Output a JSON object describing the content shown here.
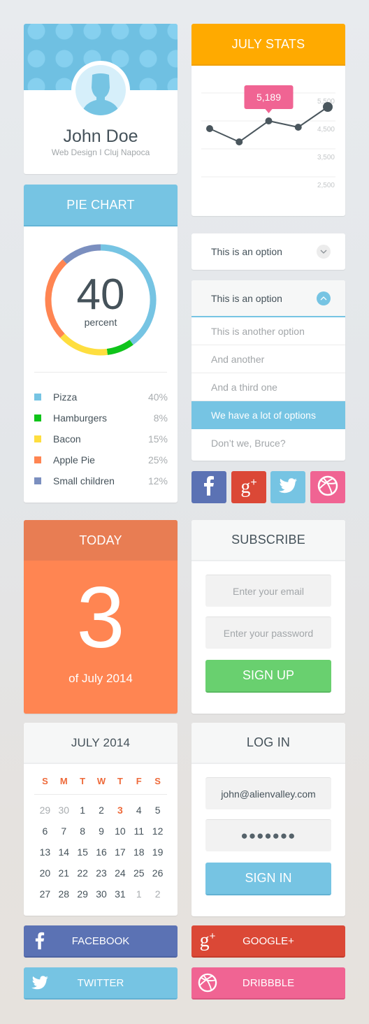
{
  "profile": {
    "name": "John Doe",
    "subtitle": "Web Design I Cluj Napoca",
    "avatar_icon": "user-silhouette-icon"
  },
  "stats": {
    "title": "JULY STATS",
    "tooltip": "5,189",
    "accent": "#ffaa00"
  },
  "chart_data": {
    "type": "line",
    "title": "JULY STATS",
    "x": [
      1,
      2,
      3,
      4,
      5
    ],
    "values": [
      4225,
      3750,
      4500,
      4275,
      5000
    ],
    "y_ticks": [
      "5,500",
      "4,500",
      "3,500",
      "2,500"
    ],
    "ylim": [
      2500,
      5500
    ],
    "grid": true,
    "annotations": [
      {
        "point_index": 2,
        "label": "5,189"
      }
    ],
    "highlight_index": 4
  },
  "pie": {
    "title": "PIE CHART",
    "center_value": "40",
    "center_label": "percent",
    "chart_data": {
      "type": "pie",
      "categories": [
        "Pizza",
        "Hamburgers",
        "Bacon",
        "Apple Pie",
        "Small children"
      ],
      "values": [
        40,
        8,
        15,
        25,
        12
      ],
      "labels": [
        "40%",
        "8%",
        "15%",
        "25%",
        "12%"
      ],
      "colors": [
        "#76c4e3",
        "#0fc41a",
        "#fede3f",
        "#ff8552",
        "#7b8fbf"
      ]
    }
  },
  "dropdown_closed": {
    "value": "This is an option",
    "icon": "chevron-down-icon"
  },
  "dropdown_open": {
    "value": "This is an option",
    "icon": "chevron-up-icon",
    "options": [
      "This is another option",
      "And another",
      "And a third one",
      "We have a lot of options",
      "Don’t we, Bruce?"
    ],
    "selected_index": 3
  },
  "social_icons": [
    {
      "name": "facebook",
      "color": "#5b72b4"
    },
    {
      "name": "google-plus",
      "color": "#db4836"
    },
    {
      "name": "twitter",
      "color": "#76c4e3"
    },
    {
      "name": "dribbble",
      "color": "#f06493"
    }
  ],
  "today": {
    "title": "TODAY",
    "day": "3",
    "month_line": "of July 2014"
  },
  "subscribe": {
    "title": "SUBSCRIBE",
    "email_placeholder": "Enter your email",
    "password_placeholder": "Enter your password",
    "button": "SIGN UP",
    "button_color": "#69d06f"
  },
  "calendar": {
    "title": "JULY 2014",
    "weekdays": [
      "S",
      "M",
      "T",
      "W",
      "T",
      "F",
      "S"
    ],
    "weeks": [
      [
        "29",
        "30",
        "1",
        "2",
        "3",
        "4",
        "5"
      ],
      [
        "6",
        "7",
        "8",
        "9",
        "10",
        "11",
        "12"
      ],
      [
        "13",
        "14",
        "15",
        "16",
        "17",
        "18",
        "19"
      ],
      [
        "20",
        "21",
        "22",
        "23",
        "24",
        "25",
        "26"
      ],
      [
        "27",
        "28",
        "29",
        "30",
        "31",
        "1",
        "2"
      ]
    ],
    "today": "3"
  },
  "login": {
    "title": "LOG IN",
    "email_value": "john@alienvalley.com",
    "password_mask": "●●●●●●●",
    "button": "SIGN IN",
    "button_color": "#76c4e3"
  },
  "social_buttons": [
    {
      "label": "FACEBOOK",
      "color": "#5b72b4"
    },
    {
      "label": "GOOGLE+",
      "color": "#db4836"
    },
    {
      "label": "TWITTER",
      "color": "#76c4e3"
    },
    {
      "label": "DRIBBBLE",
      "color": "#f06493"
    }
  ]
}
